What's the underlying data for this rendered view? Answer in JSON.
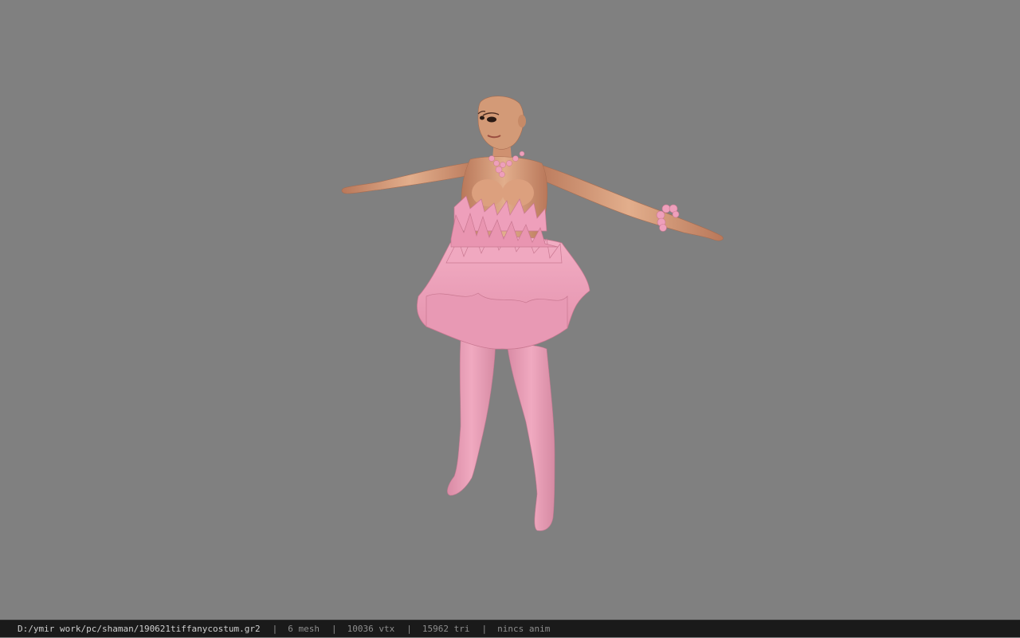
{
  "viewport": {
    "background_color": "#808080",
    "model": {
      "skin_color": "#d9a07c",
      "costume_color": "#eea2ba"
    }
  },
  "status_bar": {
    "file_path": "D:/ymir work/pc/shaman/190621tiffanycostum.gr2",
    "separator": "|",
    "mesh_count": "6 mesh",
    "vertex_count": "10036 vtx",
    "triangle_count": "15962 tri",
    "anim_status": "nincs anim"
  }
}
